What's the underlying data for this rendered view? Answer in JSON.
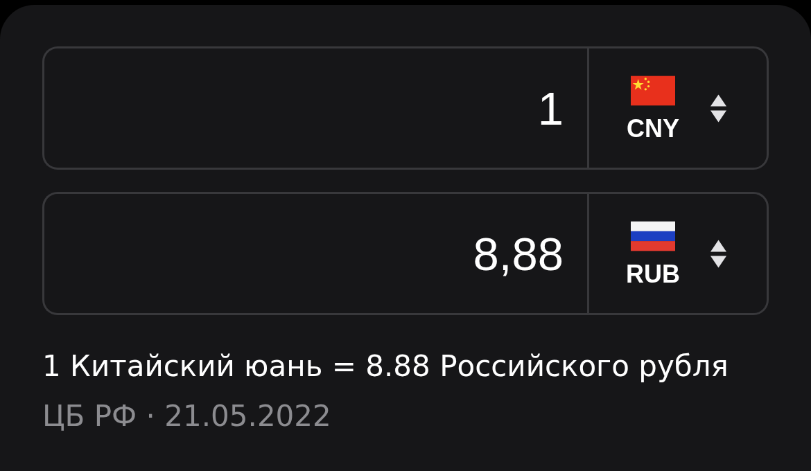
{
  "converter": {
    "rows": [
      {
        "value": "1",
        "currency": "CNY",
        "kind": "china"
      },
      {
        "value": "8,88",
        "currency": "RUB",
        "kind": "russia"
      }
    ]
  },
  "rate_text": "1 Китайский юань = 8.88 Российского рубля",
  "source": "ЦБ РФ · 21.05.2022"
}
